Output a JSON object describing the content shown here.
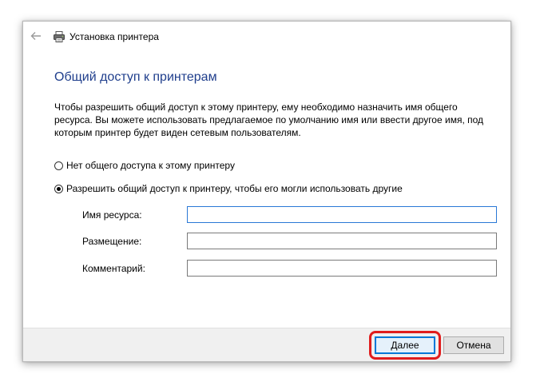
{
  "window": {
    "title": "Установка принтера"
  },
  "page": {
    "title": "Общий доступ к принтерам",
    "description": "Чтобы разрешить общий доступ к этому принтеру, ему необходимо назначить имя общего ресурса. Вы можете использовать предлагаемое по умолчанию имя или ввести другое имя, под которым принтер будет виден сетевым пользователям."
  },
  "sharing": {
    "options": [
      {
        "label": "Нет общего доступа к этому принтеру",
        "selected": false
      },
      {
        "label": "Разрешить общий доступ к принтеру, чтобы его могли использовать другие",
        "selected": true
      }
    ]
  },
  "fields": {
    "share_name": {
      "label": "Имя ресурса:",
      "value": ""
    },
    "location": {
      "label": "Размещение:",
      "value": ""
    },
    "comment": {
      "label": "Комментарий:",
      "value": ""
    }
  },
  "buttons": {
    "next": "Далее",
    "cancel": "Отмена"
  },
  "colors": {
    "title_blue": "#1f3e8c",
    "highlight_red": "#e01d1d",
    "focus_blue": "#0078d7"
  },
  "icons": {
    "back": "back-arrow-icon",
    "printer": "printer-icon"
  }
}
